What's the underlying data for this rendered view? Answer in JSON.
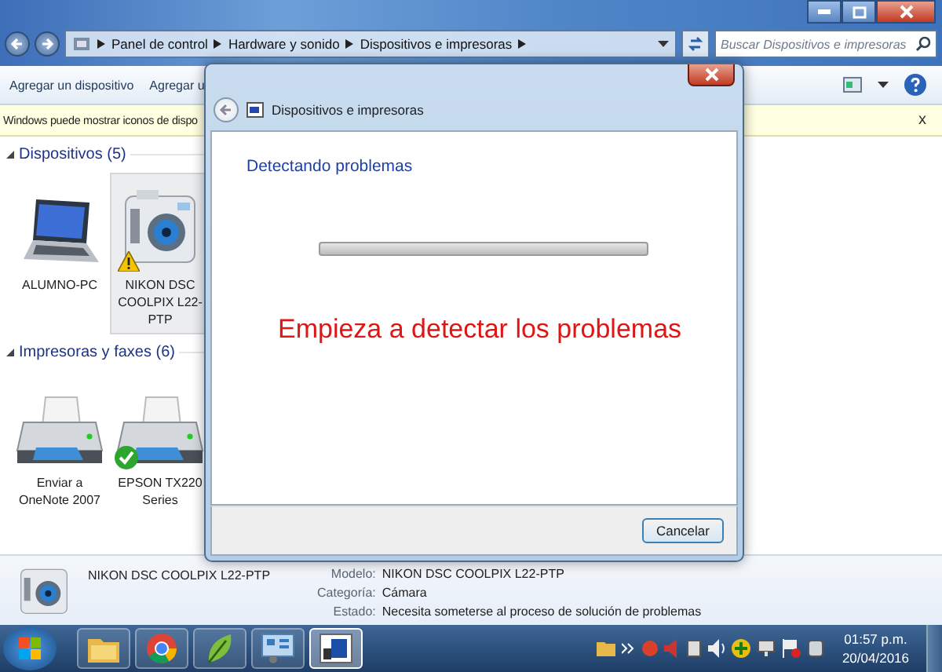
{
  "address_bar": {
    "breadcrumbs": [
      "Panel de control",
      "Hardware y sonido",
      "Dispositivos e impresoras"
    ],
    "search_placeholder": "Buscar Dispositivos e impresoras"
  },
  "toolbar": {
    "items": [
      "Agregar un dispositivo",
      "Agregar u"
    ]
  },
  "info_bar": {
    "text": "Windows puede mostrar iconos de dispo",
    "close": "x"
  },
  "groups": [
    {
      "title": "Dispositivos (5)",
      "items": [
        {
          "kind": "laptop",
          "label": "ALUMNO-PC",
          "selected": false,
          "warning": false,
          "default": false
        },
        {
          "kind": "camera",
          "label": "NIKON DSC COOLPIX L22-PTP",
          "selected": true,
          "warning": true,
          "default": false
        }
      ]
    },
    {
      "title": "Impresoras y faxes (6)",
      "items": [
        {
          "kind": "printer",
          "label": "Enviar a OneNote 2007",
          "selected": false,
          "warning": false,
          "default": false
        },
        {
          "kind": "printer",
          "label": "EPSON TX220 Series",
          "selected": false,
          "warning": false,
          "default": true
        }
      ]
    }
  ],
  "details": {
    "name": "NIKON DSC COOLPIX L22-PTP",
    "fields": [
      {
        "label": "Modelo:",
        "value": "NIKON DSC COOLPIX L22-PTP"
      },
      {
        "label": "Categoría:",
        "value": "Cámara"
      },
      {
        "label": "Estado:",
        "value": "Necesita someterse al proceso de solución de problemas"
      }
    ]
  },
  "dialog": {
    "title": "Dispositivos e impresoras",
    "heading": "Detectando problemas",
    "progress": {
      "level": 0
    },
    "annotation": "Empieza a detectar los problemas",
    "buttons": [
      "Cancelar"
    ]
  },
  "taskbar": {
    "apps": [
      {
        "kind": "folder",
        "selected": false
      },
      {
        "kind": "browser",
        "selected": false
      },
      {
        "kind": "leaf",
        "selected": false
      },
      {
        "kind": "panel",
        "selected": false
      },
      {
        "kind": "window",
        "selected": true
      }
    ],
    "time": "01:57 p.m.",
    "date": "20/04/2016"
  }
}
